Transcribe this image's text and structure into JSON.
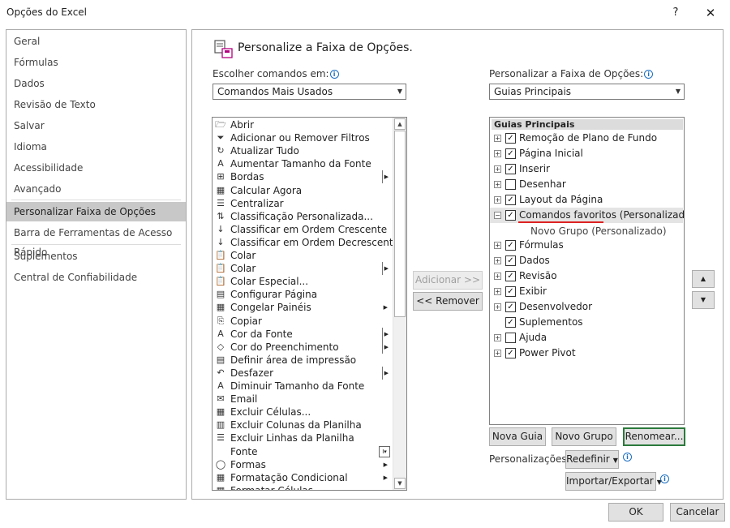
{
  "window": {
    "title": "Opções do Excel",
    "help": "?",
    "close": "✕"
  },
  "nav": {
    "items": [
      {
        "label": "Geral",
        "selected": false
      },
      {
        "label": "Fórmulas",
        "selected": false
      },
      {
        "label": "Dados",
        "selected": false
      },
      {
        "label": "Revisão de Texto",
        "selected": false
      },
      {
        "label": "Salvar",
        "selected": false
      },
      {
        "label": "Idioma",
        "selected": false
      },
      {
        "label": "Acessibilidade",
        "selected": false
      },
      {
        "label": "Avançado",
        "selected": false
      },
      {
        "label": "Personalizar Faixa de Opções",
        "selected": true
      },
      {
        "label": "Barra de Ferramentas de Acesso Rápido",
        "selected": false
      },
      {
        "label": "Suplementos",
        "selected": false
      },
      {
        "label": "Central de Confiabilidade",
        "selected": false
      }
    ]
  },
  "main": {
    "heading": "Personalize a Faixa de Opções.",
    "choose_label": "Escolher comandos em:",
    "choose_value": "Comandos Mais Usados",
    "customize_label": "Personalizar a Faixa de Opções:",
    "customize_value": "Guias Principais",
    "commands": [
      {
        "label": "Abrir",
        "icon": "🗁",
        "sub": ""
      },
      {
        "label": "Adicionar ou Remover Filtros",
        "icon": "⏷",
        "sub": ""
      },
      {
        "label": "Atualizar Tudo",
        "icon": "↻",
        "sub": ""
      },
      {
        "label": "Aumentar Tamanho da Fonte",
        "icon": "A",
        "sub": ""
      },
      {
        "label": "Bordas",
        "icon": "⊞",
        "sub": "bar"
      },
      {
        "label": "Calcular Agora",
        "icon": "▦",
        "sub": ""
      },
      {
        "label": "Centralizar",
        "icon": "☰",
        "sub": ""
      },
      {
        "label": "Classificação Personalizada...",
        "icon": "⇅",
        "sub": ""
      },
      {
        "label": "Classificar em Ordem Crescente",
        "icon": "↓",
        "sub": ""
      },
      {
        "label": "Classificar em Ordem Decrescente",
        "icon": "↓",
        "sub": ""
      },
      {
        "label": "Colar",
        "icon": "📋",
        "sub": ""
      },
      {
        "label": "Colar",
        "icon": "📋",
        "sub": "bar"
      },
      {
        "label": "Colar Especial...",
        "icon": "📋",
        "sub": ""
      },
      {
        "label": "Configurar Página",
        "icon": "▤",
        "sub": ""
      },
      {
        "label": "Congelar Painéis",
        "icon": "▦",
        "sub": "arrow"
      },
      {
        "label": "Copiar",
        "icon": "⎘",
        "sub": ""
      },
      {
        "label": "Cor da Fonte",
        "icon": "A",
        "sub": "bar"
      },
      {
        "label": "Cor do Preenchimento",
        "icon": "◇",
        "sub": "bar"
      },
      {
        "label": "Definir área de impressão",
        "icon": "▤",
        "sub": ""
      },
      {
        "label": "Desfazer",
        "icon": "↶",
        "sub": "bar"
      },
      {
        "label": "Diminuir Tamanho da Fonte",
        "icon": "A",
        "sub": ""
      },
      {
        "label": "Email",
        "icon": "✉",
        "sub": ""
      },
      {
        "label": "Excluir Células...",
        "icon": "▦",
        "sub": ""
      },
      {
        "label": "Excluir Colunas da Planilha",
        "icon": "▥",
        "sub": ""
      },
      {
        "label": "Excluir Linhas da Planilha",
        "icon": "☰",
        "sub": ""
      },
      {
        "label": "Fonte",
        "icon": "",
        "sub": "box"
      },
      {
        "label": "Formas",
        "icon": "◯",
        "sub": "arrow"
      },
      {
        "label": "Formatação Condicional",
        "icon": "▦",
        "sub": "arrow"
      },
      {
        "label": "Formatar Células...",
        "icon": "▦",
        "sub": ""
      }
    ],
    "add_button": "Adicionar >>",
    "remove_button": "<< Remover",
    "tree_header": "Guias Principais",
    "tree": [
      {
        "label": "Remoção de Plano de Fundo",
        "checked": true,
        "expander": "⊞"
      },
      {
        "label": "Página Inicial",
        "checked": true,
        "expander": "⊞"
      },
      {
        "label": "Inserir",
        "checked": true,
        "expander": "⊞"
      },
      {
        "label": "Desenhar",
        "checked": false,
        "expander": "⊞"
      },
      {
        "label": "Layout da Página",
        "checked": true,
        "expander": "⊞"
      },
      {
        "label": "Comandos favoritos (Personalizado)",
        "checked": true,
        "expander": "⊟",
        "highlight": true
      },
      {
        "label": "Novo Grupo (Personalizado)",
        "group": true
      },
      {
        "label": "Fórmulas",
        "checked": true,
        "expander": "⊞"
      },
      {
        "label": "Dados",
        "checked": true,
        "expander": "⊞"
      },
      {
        "label": "Revisão",
        "checked": true,
        "expander": "⊞"
      },
      {
        "label": "Exibir",
        "checked": true,
        "expander": "⊞"
      },
      {
        "label": "Desenvolvedor",
        "checked": true,
        "expander": "⊞"
      },
      {
        "label": "Suplementos",
        "checked": true,
        "expander": ""
      },
      {
        "label": "Ajuda",
        "checked": false,
        "expander": "⊞"
      },
      {
        "label": "Power Pivot",
        "checked": true,
        "expander": "⊞"
      }
    ],
    "new_tab_button": "Nova Guia",
    "new_group_button": "Novo Grupo",
    "rename_button": "Renomear...",
    "customizations_label": "Personalizações:",
    "reset_button": "Redefinir",
    "import_export_button": "Importar/Exportar"
  },
  "footer": {
    "ok": "OK",
    "cancel": "Cancelar"
  }
}
